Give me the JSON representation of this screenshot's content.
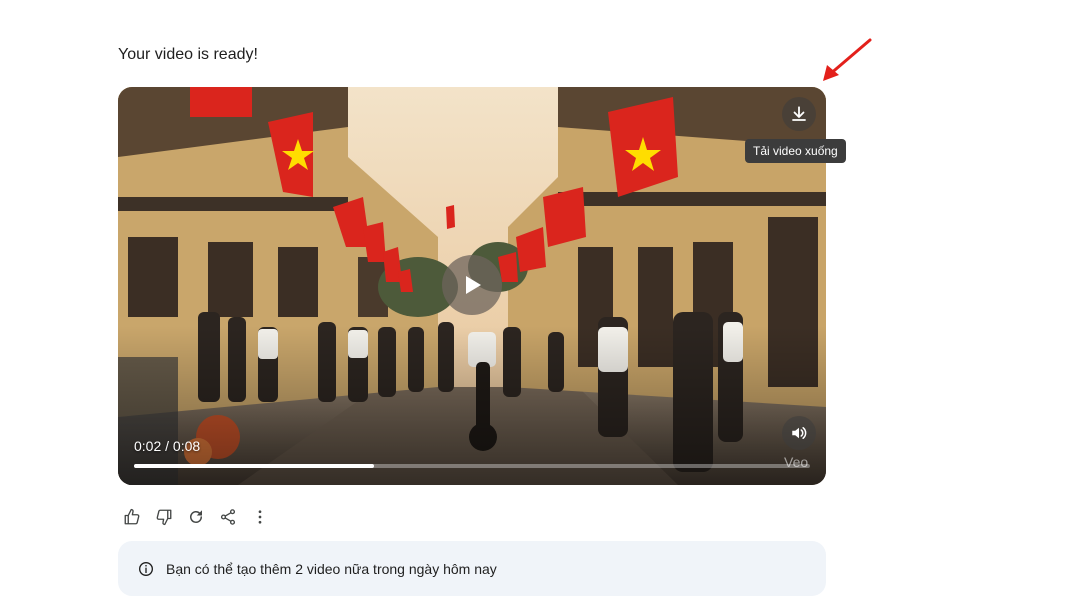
{
  "message": {
    "ready_text": "Your video is ready!"
  },
  "video": {
    "current_time": "0:02",
    "duration": "0:08",
    "progress": 0.355,
    "watermark": "Veo",
    "download_tooltip": "Tải video xuống",
    "flag_colors": {
      "red": "#da251d",
      "star": "#ffdd00"
    }
  },
  "actions": [
    "thumbs-up-icon",
    "thumbs-down-icon",
    "refresh-icon",
    "share-icon",
    "more-vert-icon"
  ],
  "banner": {
    "text": "Bạn có thể tạo thêm 2 video nữa trong ngày hôm nay"
  },
  "annotation": {
    "arrow_color": "#e3201b"
  }
}
